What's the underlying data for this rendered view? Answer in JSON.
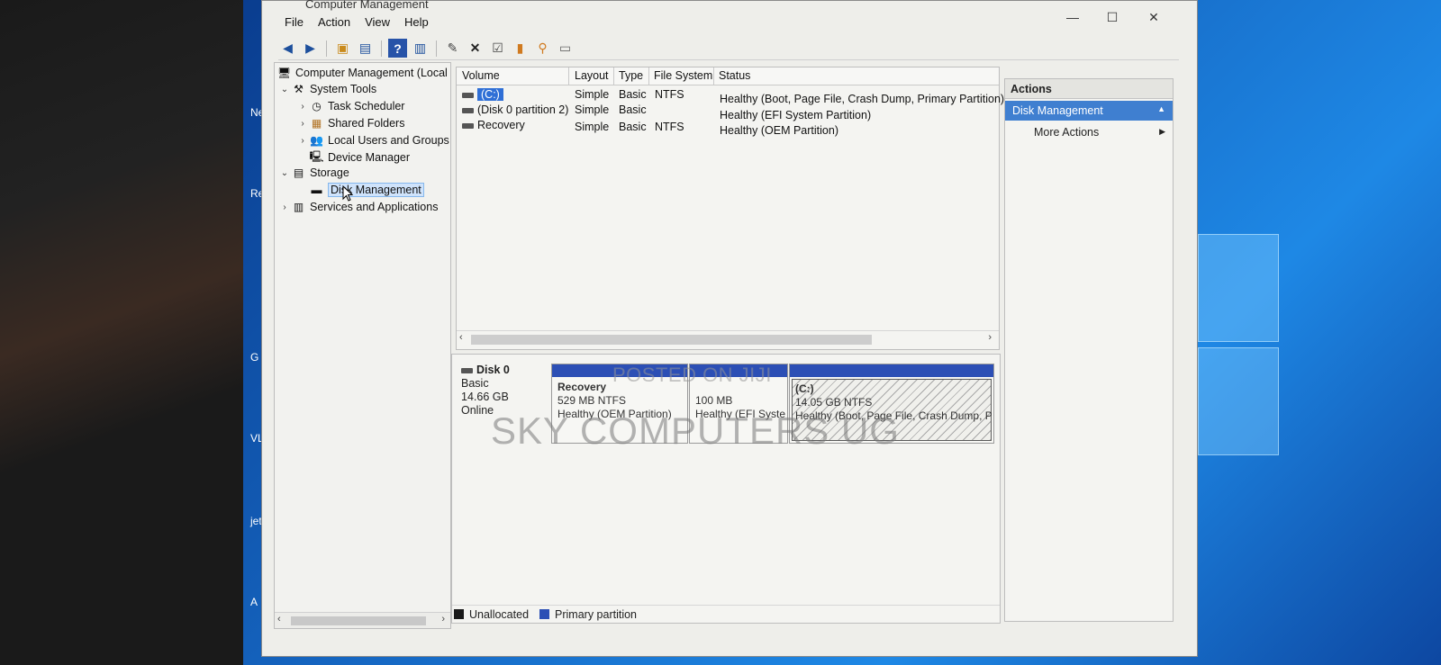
{
  "window": {
    "title": "Computer Management",
    "controls": {
      "minimize": "—",
      "maximize": "☐",
      "close": "✕"
    }
  },
  "menu": [
    "File",
    "Action",
    "View",
    "Help"
  ],
  "toolbar": {
    "icons": [
      "back-arrow-icon",
      "forward-arrow-icon",
      "up-folder-icon",
      "show-hide-tree-icon",
      "help-icon",
      "properties-icon",
      "connect-icon",
      "delete-icon",
      "check-icon",
      "export-icon",
      "search-icon",
      "view-icon"
    ]
  },
  "tree": {
    "root": "Computer Management (Local",
    "system_tools": "System Tools",
    "task_scheduler": "Task Scheduler",
    "shared_folders": "Shared Folders",
    "local_users": "Local Users and Groups",
    "device_manager": "Device Manager",
    "storage": "Storage",
    "disk_management": "Disk Management",
    "services": "Services and Applications"
  },
  "volumes": {
    "headers": [
      "Volume",
      "Layout",
      "Type",
      "File System",
      "Status"
    ],
    "rows": [
      {
        "volume": "(C:)",
        "layout": "Simple",
        "type": "Basic",
        "fs": "NTFS",
        "status": "Healthy (Boot, Page File, Crash Dump, Primary Partition)"
      },
      {
        "volume": "(Disk 0 partition 2)",
        "layout": "Simple",
        "type": "Basic",
        "fs": "",
        "status": "Healthy (EFI System Partition)"
      },
      {
        "volume": "Recovery",
        "layout": "Simple",
        "type": "Basic",
        "fs": "NTFS",
        "status": "Healthy (OEM Partition)"
      }
    ]
  },
  "disk": {
    "name": "Disk 0",
    "kind": "Basic",
    "size": "14.66 GB",
    "state": "Online",
    "partitions": [
      {
        "name": "Recovery",
        "size": "529 MB NTFS",
        "status": "Healthy (OEM Partition)"
      },
      {
        "name": "",
        "size": "100 MB",
        "status": "Healthy (EFI Syste"
      },
      {
        "name": "(C:)",
        "size": "14.05 GB NTFS",
        "status": "Healthy (Boot, Page File, Crash Dump, Pi"
      }
    ]
  },
  "legend": {
    "unallocated": "Unallocated",
    "primary": "Primary partition",
    "unallocated_color": "#1a1a1a",
    "primary_color": "#2c4fb5"
  },
  "actions": {
    "title": "Actions",
    "section": "Disk Management",
    "more": "More Actions"
  },
  "watermark": {
    "line1": "POSTED ON JIJI",
    "line2": "SKY COMPUTERS UG"
  },
  "desktop_icons": [
    "Ne",
    "Re",
    "G",
    "VLC",
    "jet",
    "A"
  ]
}
